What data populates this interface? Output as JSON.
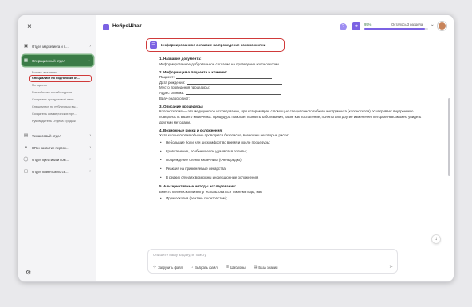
{
  "sidebar": {
    "close_label": "×",
    "groups": [
      {
        "label": "Отдел маркетинга и п...",
        "icon": "building-icon"
      },
      {
        "label": "Операционный отдел",
        "icon": "grid-icon"
      },
      {
        "label": "Финансовый отдел",
        "icon": "wallet-icon"
      },
      {
        "label": "HR и развитие персон...",
        "icon": "people-icon"
      },
      {
        "label": "Отдел креатива и ком...",
        "icon": "chat-icon"
      },
      {
        "label": "Отдел клиентского се...",
        "icon": "monitor-icon"
      }
    ],
    "sub_items": [
      "Бизнес-аналитик",
      "Специалист по подготовке от...",
      "Методолог",
      "Разработчик онлайн-курсов",
      "Создатель продуктовой лине...",
      "Специалист по публичным вы...",
      "Создатель коммерческих пре...",
      "Руководитель Отдела Продаж"
    ]
  },
  "header": {
    "app_title": "НейроШтат",
    "quota_percent": "95%",
    "quota_text": "Осталось 3 раздела",
    "quota_fraction": 0.95
  },
  "document": {
    "title": "Информированное согласие на проведение колоноскопии",
    "sections": [
      {
        "heading": "1. Название документа:",
        "text": "Информированное добровольное согласие на проведение колоноскопии"
      },
      {
        "heading": "2. Информация о пациенте и клинике:",
        "fields": [
          "Пациент:",
          "Дата рождения:",
          "Место проведения процедуры:",
          "Адрес клиники:",
          "Врач-эндоскопист:"
        ]
      },
      {
        "heading": "3. Описание процедуры:",
        "text": "Колоноскопия — это медицинское исследование, при котором врач с помощью специального гибкого инструмента (колоноскопа) осматривает внутреннюю поверхность вашего кишечника. Процедура помогает выявить заболевания, такие как воспаление, полипы или другие изменения, которые невозможно увидеть другими методами."
      },
      {
        "heading": "4. Возможные риски и осложнения:",
        "text": "Хотя колоноскопия обычно проводится безопасно, возможны некоторые риски:",
        "bullets": [
          "Небольшие боли или дискомфорт во время и после процедуры;",
          "Кровотечение, особенно если удаляются полипы;",
          "Повреждение стенки кишечника (очень редко);",
          "Реакция на применяемые лекарства;",
          "В редких случаях возможны инфекционные осложнения."
        ]
      },
      {
        "heading": "5. Альтернативные методы исследования:",
        "text": "Вместо колоноскопии могут использоваться такие методы, как:",
        "bullets": [
          "Ирригоскопия (рентген с контрастом);"
        ]
      }
    ]
  },
  "composer": {
    "placeholder": "Опишите вашу задачу, и помогу",
    "tools": [
      {
        "label": "Загрузить файл",
        "icon": "paperclip-icon"
      },
      {
        "label": "Выбрать файл",
        "icon": "folder-icon"
      },
      {
        "label": "Шаблоны",
        "icon": "template-icon"
      },
      {
        "label": "База знаний",
        "icon": "book-icon"
      }
    ]
  }
}
